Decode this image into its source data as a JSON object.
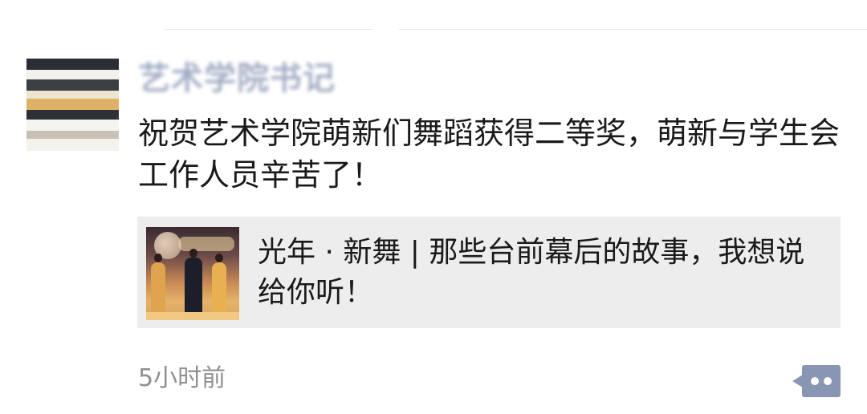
{
  "post": {
    "author_name": "艺术学院书记",
    "text": "祝贺艺术学院萌新们舞蹈获得二等奖，萌新与学生会工作人员辛苦了！",
    "time": "5小时前"
  },
  "shared_article": {
    "title": "光年 · 新舞 | 那些台前幕后的故事，我想说给你听！"
  },
  "icons": {
    "more": "more-dots-icon",
    "avatar": "avatar-image",
    "thumbnail": "article-thumbnail-image"
  },
  "colors": {
    "author_name": "#576b95",
    "more_button": "#8896b3",
    "card_background": "#ededed",
    "time_text": "#8f8f8f"
  }
}
